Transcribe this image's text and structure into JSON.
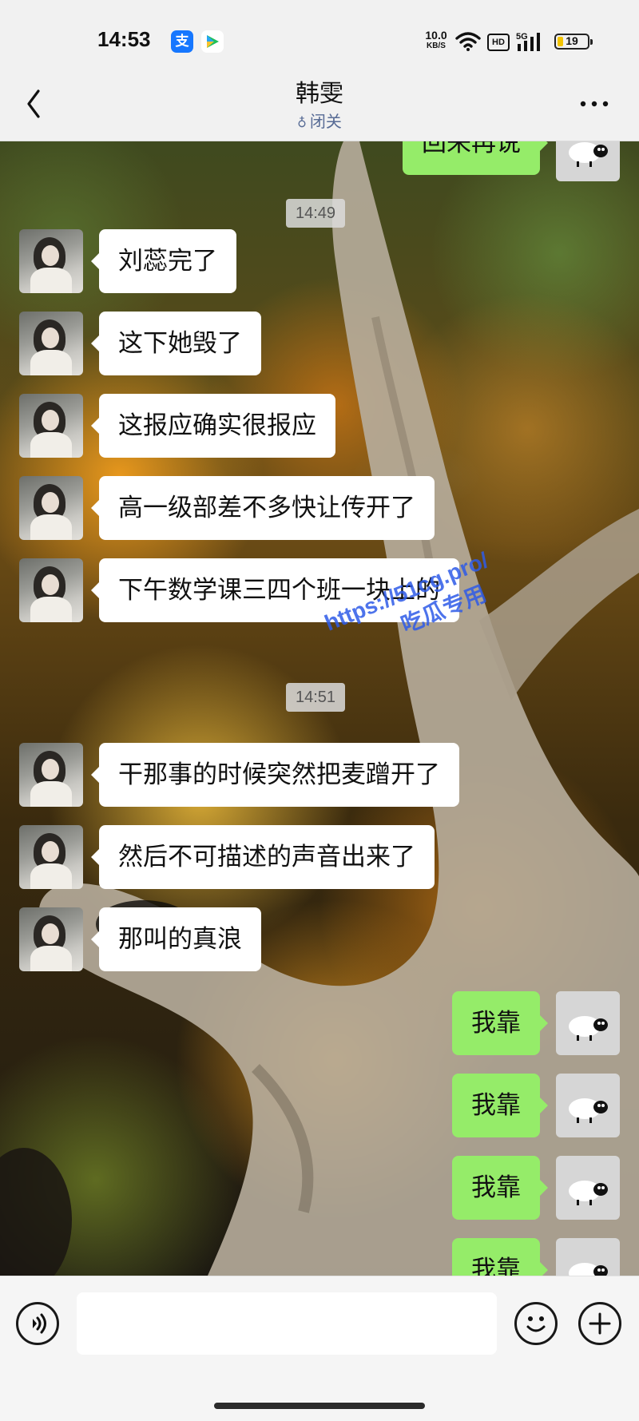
{
  "status_bar": {
    "time": "14:53",
    "alipay_glyph": "支",
    "net_speed_value": "10.0",
    "net_speed_unit": "KB/S",
    "hd_label": "HD",
    "signal_label": "5G",
    "battery": "19",
    "battery_level": 0.19,
    "icons": [
      "alipay-icon",
      "video-icon",
      "wifi-icon",
      "hd-icon",
      "signal-icon",
      "battery-icon"
    ]
  },
  "header": {
    "contact_name": "韩雯",
    "status_icon": "♁",
    "status_text": "闭关",
    "icons": [
      "back-icon",
      "more-icon"
    ]
  },
  "chat": {
    "top_partial_message": "回来再说",
    "time_1": "14:49",
    "time_2": "14:51",
    "incoming": [
      "刘蕊完了",
      "这下她毁了",
      "这报应确实很报应",
      "高一级部差不多快让传开了",
      "下午数学课三四个班一块上的",
      "干那事的时候突然把麦蹭开了",
      "然后不可描述的声音出来了",
      "那叫的真浪"
    ],
    "outgoing": [
      "我靠",
      "我靠",
      "我靠",
      "我靠"
    ]
  },
  "watermark": {
    "line1": "https://51cg.pro/",
    "line2": "吃瓜专用"
  },
  "input_bar": {
    "placeholder": "",
    "icons": [
      "voice-icon",
      "emoji-icon",
      "plus-icon"
    ]
  },
  "colors": {
    "outgoing_bubble": "#95ec69",
    "incoming_bubble": "#ffffff",
    "link_blue": "#576b95",
    "watermark_blue": "#2e5be8"
  }
}
